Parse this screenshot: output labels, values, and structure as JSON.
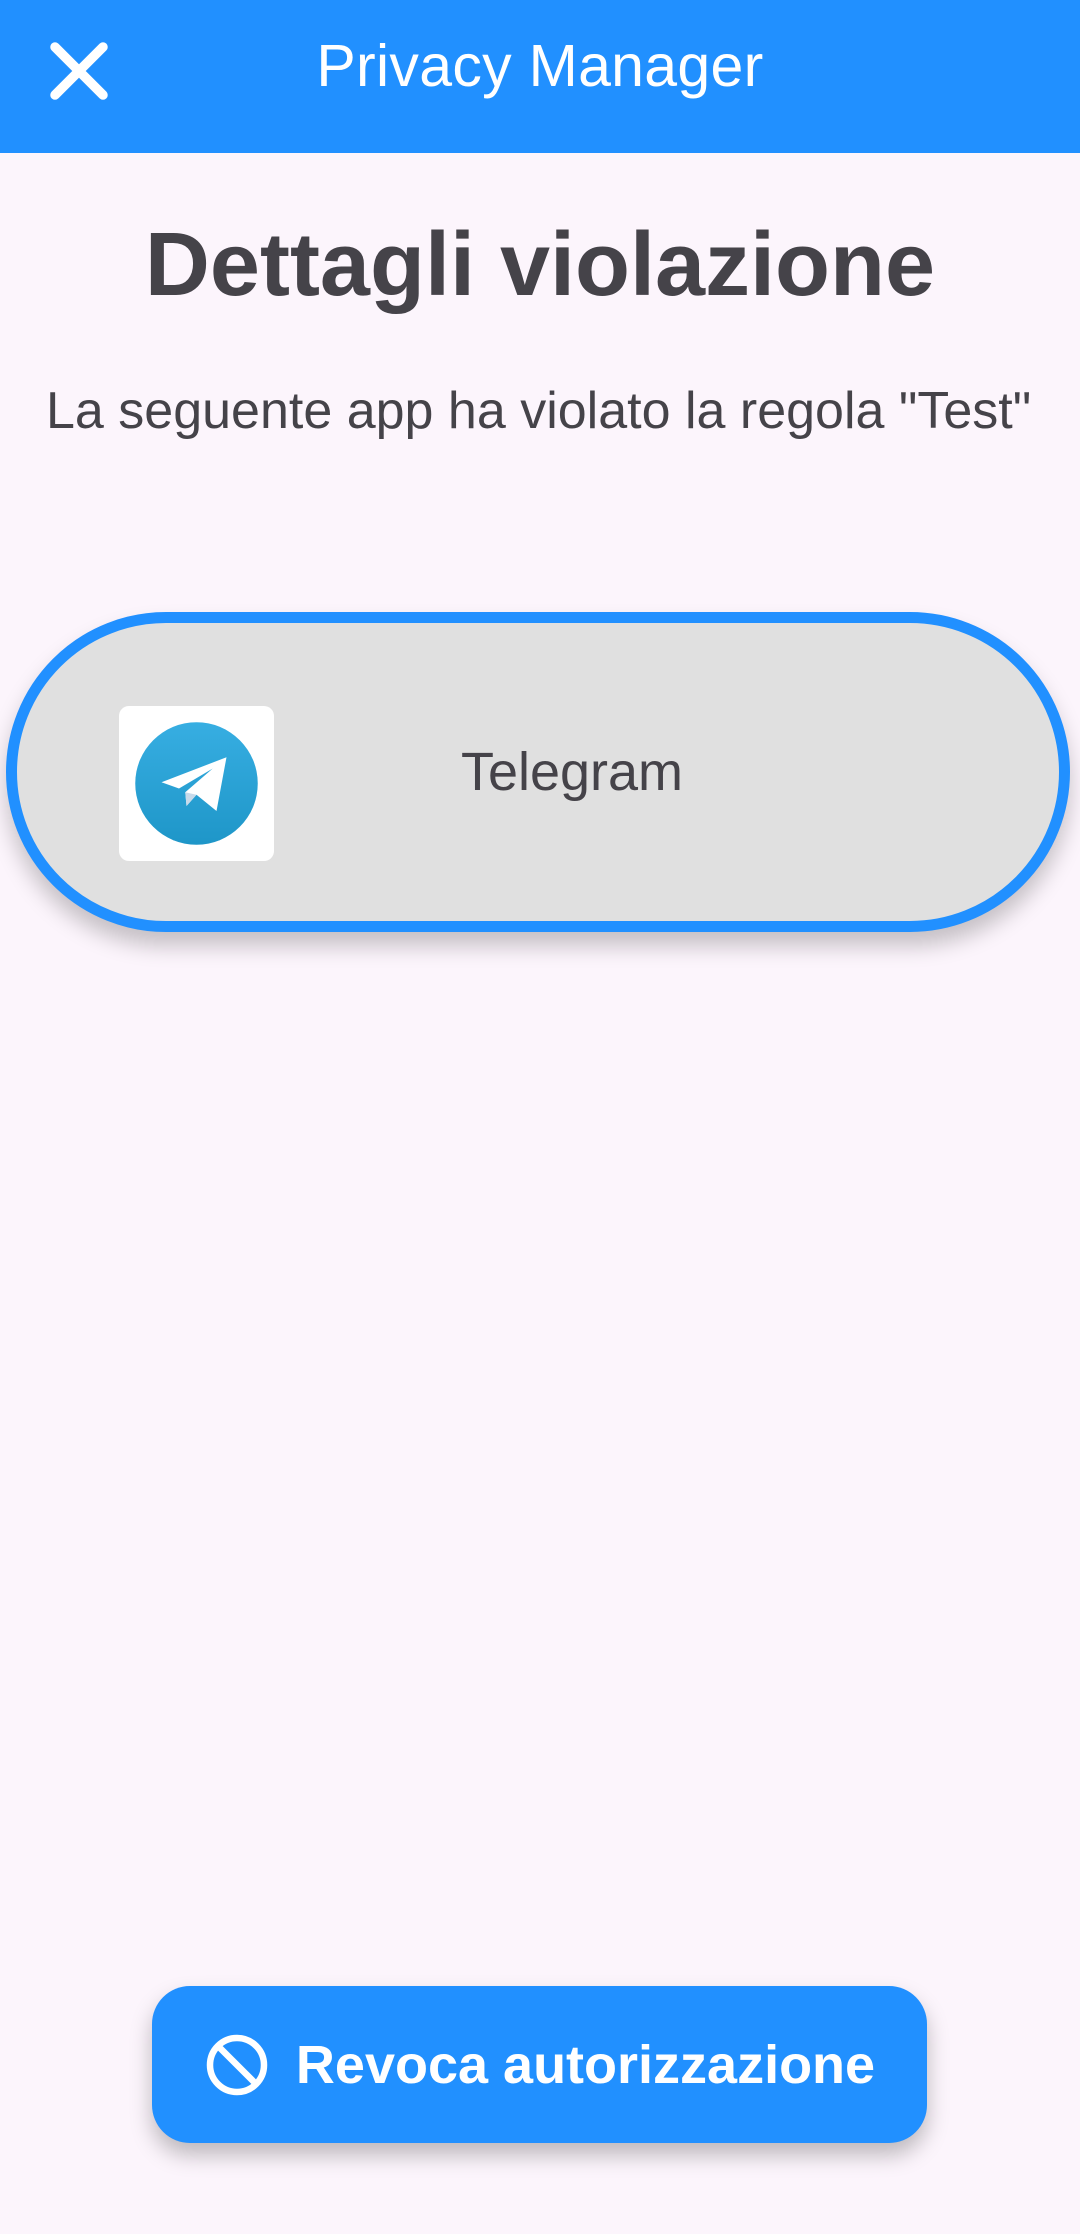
{
  "app_bar": {
    "title": "Privacy Manager",
    "close_icon": "close-icon",
    "background_color": "#2190FF"
  },
  "page": {
    "title": "Dettagli violazione",
    "description": "La seguente app ha violato la regola \"Test\""
  },
  "violating_app": {
    "name": "Telegram",
    "icon": "telegram-icon",
    "border_color": "#2190FF"
  },
  "actions": {
    "revoke_label": "Revoca autorizzazione",
    "revoke_icon": "block-icon"
  }
}
